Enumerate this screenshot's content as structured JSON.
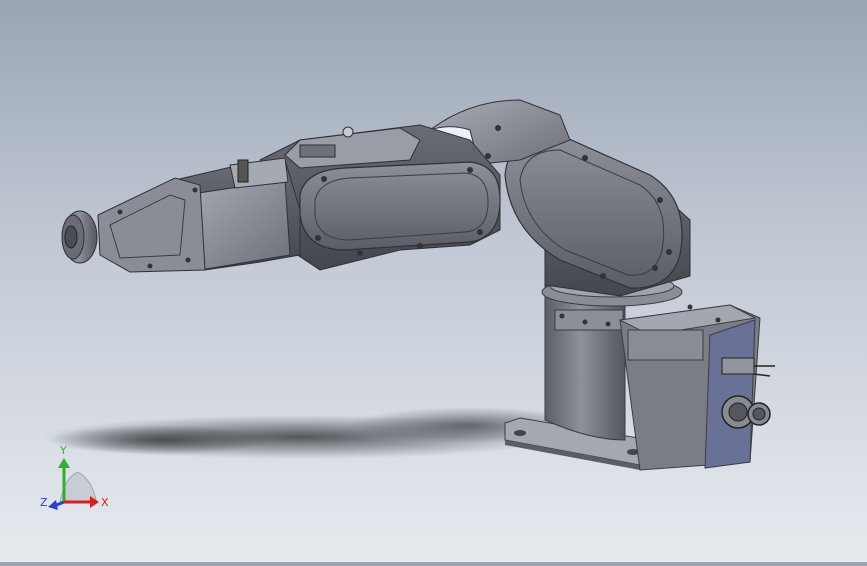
{
  "view": {
    "background_top": "#9aa5b4",
    "background_bottom": "#e7eaef",
    "model_color": "#7a7c86"
  },
  "triad": {
    "x_label": "X",
    "y_label": "Y",
    "z_label": "Z",
    "x_color": "#d42020",
    "y_color": "#2fb12f",
    "z_color": "#2a3fd0"
  }
}
